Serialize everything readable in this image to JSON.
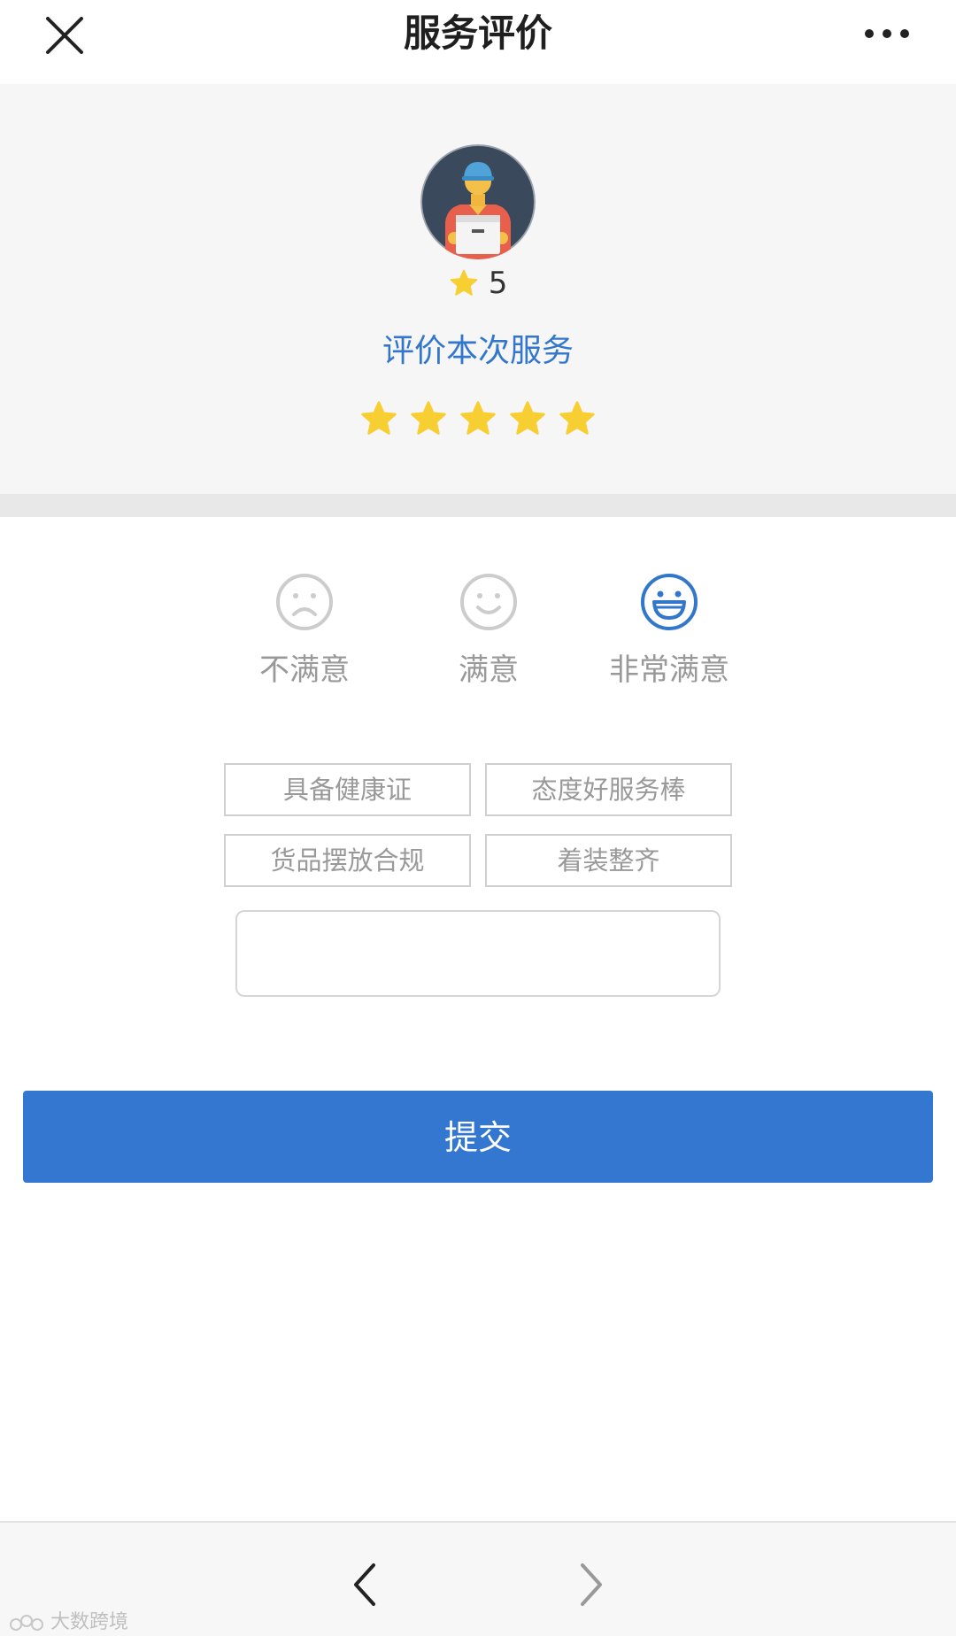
{
  "topbar": {
    "title": "服务评价",
    "close_icon": "close-icon",
    "more_icon": "more-dots-icon"
  },
  "courier": {
    "avatar_icon": "courier-avatar",
    "rating_icon": "star-icon",
    "rating_value": "5"
  },
  "rate_prompt": "评价本次服务",
  "stars": {
    "count": 5,
    "selected": 5,
    "color": "#f7cf33"
  },
  "satisfaction": {
    "options": [
      {
        "label": "不满意",
        "icon": "sad-face-icon",
        "selected": false
      },
      {
        "label": "满意",
        "icon": "smile-face-icon",
        "selected": false
      },
      {
        "label": "非常满意",
        "icon": "laugh-face-icon",
        "selected": true
      }
    ],
    "selected_color": "#3377cc",
    "unselected_color": "#cccccc"
  },
  "tags": [
    {
      "label": "具备健康证"
    },
    {
      "label": "态度好服务棒"
    },
    {
      "label": "货品摆放合规"
    },
    {
      "label": "着装整齐"
    }
  ],
  "comment": {
    "value": "",
    "placeholder": ""
  },
  "submit": {
    "label": "提交",
    "color": "#3477d0"
  },
  "bottombar": {
    "back_icon": "chevron-left-icon",
    "forward_icon": "chevron-right-icon",
    "watermark_text": "大数跨境"
  }
}
